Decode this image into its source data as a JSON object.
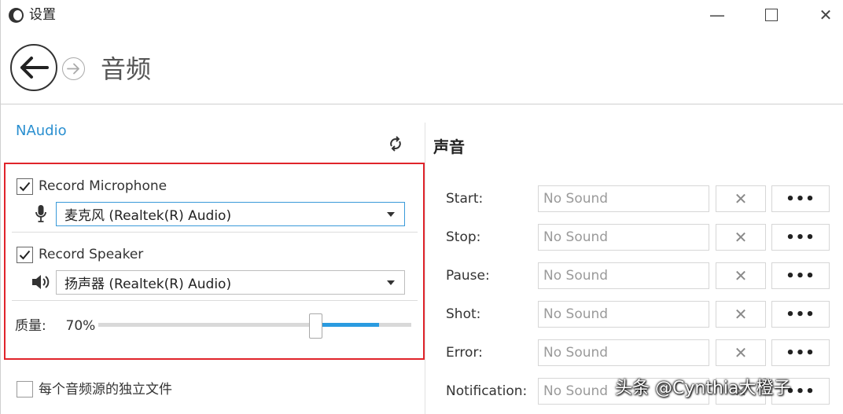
{
  "window": {
    "title": "设置",
    "minimize_glyph": "—",
    "maximize_glyph": "☐",
    "close_glyph": "✕"
  },
  "header": {
    "title": "音频"
  },
  "left_panel": {
    "provider": "NAudio",
    "microphone": {
      "checked": true,
      "label": "Record Microphone",
      "device": "麦克风 (Realtek(R) Audio)"
    },
    "speaker": {
      "checked": true,
      "label": "Record Speaker",
      "device": "扬声器 (Realtek(R) Audio)"
    },
    "quality": {
      "label": "质量:",
      "value_text": "70%",
      "value": 70
    },
    "separate_files": {
      "checked": false,
      "label": "每个音频源的独立文件"
    }
  },
  "right_panel": {
    "heading": "声音",
    "rows": [
      {
        "label": "Start:",
        "value": "No Sound"
      },
      {
        "label": "Stop:",
        "value": "No Sound"
      },
      {
        "label": "Pause:",
        "value": "No Sound"
      },
      {
        "label": "Shot:",
        "value": "No Sound"
      },
      {
        "label": "Error:",
        "value": "No Sound"
      },
      {
        "label": "Notification:",
        "value": "No Sound"
      }
    ],
    "clear_glyph": "✕",
    "browse_glyph": "•••"
  },
  "watermark": "头条 @Cynthia大橙子",
  "colors": {
    "accent": "#2a8fd0",
    "highlight_box": "#e0242b",
    "slider_fill": "#2a9be0"
  }
}
